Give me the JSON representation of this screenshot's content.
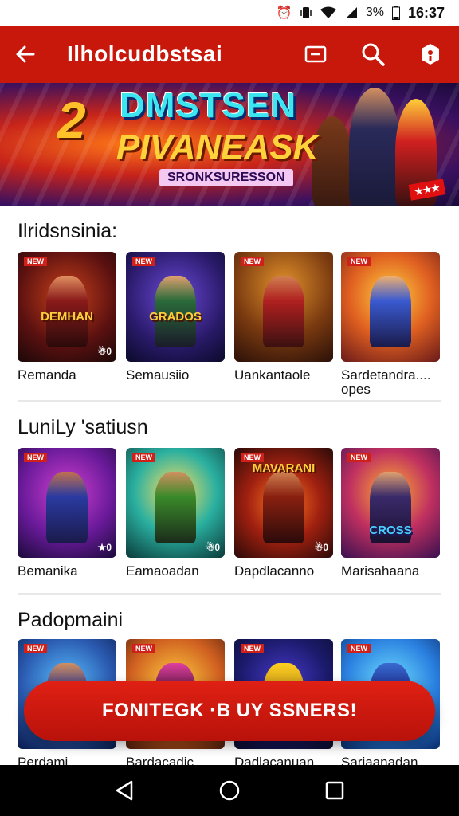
{
  "status": {
    "time": "16:37",
    "battery": "3%",
    "icons": [
      "alarm-icon",
      "vibrate-icon",
      "wifi-icon",
      "signal-icon",
      "battery-icon"
    ]
  },
  "appbar": {
    "title": "Ilholcudbstsai",
    "icons": [
      "back-arrow-icon",
      "cast-icon",
      "search-icon",
      "account-icon"
    ],
    "color": "#c8180c"
  },
  "banner": {
    "number": "2",
    "line1": "DMSTSEN",
    "line2": "PIVANEASK",
    "subtitle": "SRONKSURESSON"
  },
  "sections": [
    {
      "title": "Ilridsnsinia:",
      "items": [
        {
          "label": "Remanda",
          "tag": "NEW",
          "count": "☃0",
          "logo": "DEMHAN"
        },
        {
          "label": "Semausiio",
          "tag": "NEW",
          "count": "",
          "logo": "GRADOS"
        },
        {
          "label": "Uankantaole",
          "tag": "NEW",
          "count": "",
          "logo": ""
        },
        {
          "label": "Sardetandra....",
          "label2": "opes",
          "tag": "NEW",
          "count": "",
          "logo": ""
        }
      ]
    },
    {
      "title": "LuniLy 'satiusn",
      "items": [
        {
          "label": "Bemanika",
          "tag": "NEW",
          "count": "★0",
          "logo": ""
        },
        {
          "label": "Eamaoadan",
          "tag": "NEW",
          "count": "☃0",
          "logo": ""
        },
        {
          "label": "Dapdlacanno",
          "tag": "NEW",
          "count": "☃0",
          "logo": "MAVARANI"
        },
        {
          "label": "Marisahaana",
          "tag": "NEW",
          "count": "",
          "logo": "CROSS"
        }
      ]
    },
    {
      "title": "Padopmaini",
      "items": [
        {
          "label": "Perdami",
          "tag": "NEW"
        },
        {
          "label": "Bardacadic",
          "tag": "NEW"
        },
        {
          "label": "Dadlacanuan",
          "tag": "NEW"
        },
        {
          "label": "Sariaanadan",
          "tag": "NEW"
        }
      ]
    }
  ],
  "cta": {
    "label": "FONITEGK ·B UY SSNERS!"
  },
  "navbar": {
    "icons": [
      "nav-back-icon",
      "nav-home-icon",
      "nav-recents-icon"
    ]
  }
}
